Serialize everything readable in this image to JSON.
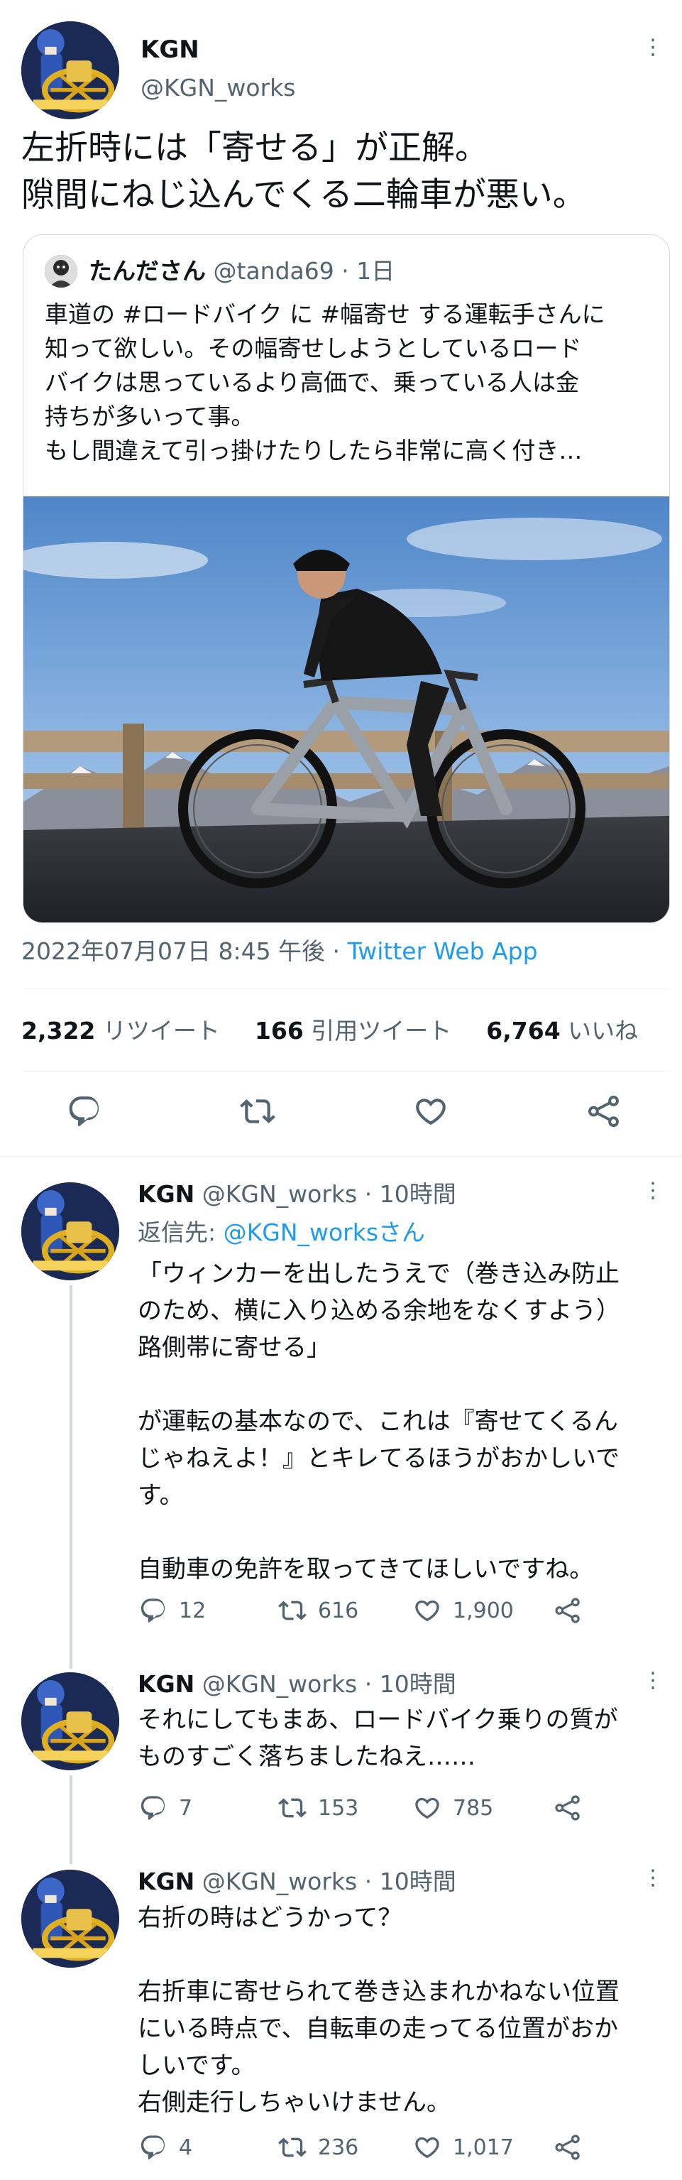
{
  "main_tweet": {
    "display_name": "KGN",
    "handle": "@KGN_works",
    "more": "⋮",
    "text_line1": "左折時には「寄せる」が正解。",
    "text_line2": "隙間にねじ込んでくる二輪車が悪い。",
    "quoted": {
      "display_name": "たんださん",
      "handle": "@tanda69",
      "time": "· 1日",
      "lines": [
        "車道の #ロードバイク に #幅寄せ する運転手さんに",
        "知って欲しい。その幅寄せしようとしているロード",
        "バイクは思っているより高価で、乗っている人は金",
        "持ちが多いって事。",
        "もし間違えて引っ掛けたりしたら非常に高く付き…"
      ]
    },
    "timestamp": "2022年07月07日 8:45 午後",
    "separator": " · ",
    "client": "Twitter Web App",
    "stats": {
      "retweets_num": "2,322",
      "retweets_label": "リツイート",
      "quotes_num": "166",
      "quotes_label": "引用ツイート",
      "likes_num": "6,764",
      "likes_label": "いいね"
    }
  },
  "replies": [
    {
      "display_name": "KGN",
      "handle": "@KGN_works",
      "time": "· 10時間",
      "reply_to_prefix": "返信先: ",
      "reply_to_handle": "@KGN_worksさん",
      "lines": [
        "「ウィンカーを出したうえで（巻き込み防止",
        "のため、横に入り込める余地をなくすよう）",
        "路側帯に寄せる」",
        "",
        "が運転の基本なので、これは『寄せてくるん",
        "じゃねえよ！』とキレてるほうがおかしいで",
        "す。",
        "",
        "自動車の免許を取ってきてほしいですね。"
      ],
      "replies": "12",
      "retweets": "616",
      "likes": "1,900"
    },
    {
      "display_name": "KGN",
      "handle": "@KGN_works",
      "time": "· 10時間",
      "lines": [
        "それにしてもまあ、ロードバイク乗りの質が",
        "ものすごく落ちましたねえ……"
      ],
      "replies": "7",
      "retweets": "153",
      "likes": "785"
    },
    {
      "display_name": "KGN",
      "handle": "@KGN_works",
      "time": "· 10時間",
      "lines": [
        "右折の時はどうかって？",
        "",
        "右折車に寄せられて巻き込まれかねない位置",
        "にいる時点で、自転車の走ってる位置がおか",
        "しいです。",
        "右側走行しちゃいけません。"
      ],
      "replies": "4",
      "retweets": "236",
      "likes": "1,017"
    }
  ],
  "icons": {
    "reply": "reply-icon",
    "retweet": "retweet-icon",
    "like": "heart-icon",
    "share": "share-icon",
    "more": "more-icon"
  },
  "colors": {
    "text": "#0f1419",
    "secondary": "#536471",
    "link": "#1d9bf0",
    "border": "#cfd9de",
    "avatar_yellow": "#e0b020"
  }
}
